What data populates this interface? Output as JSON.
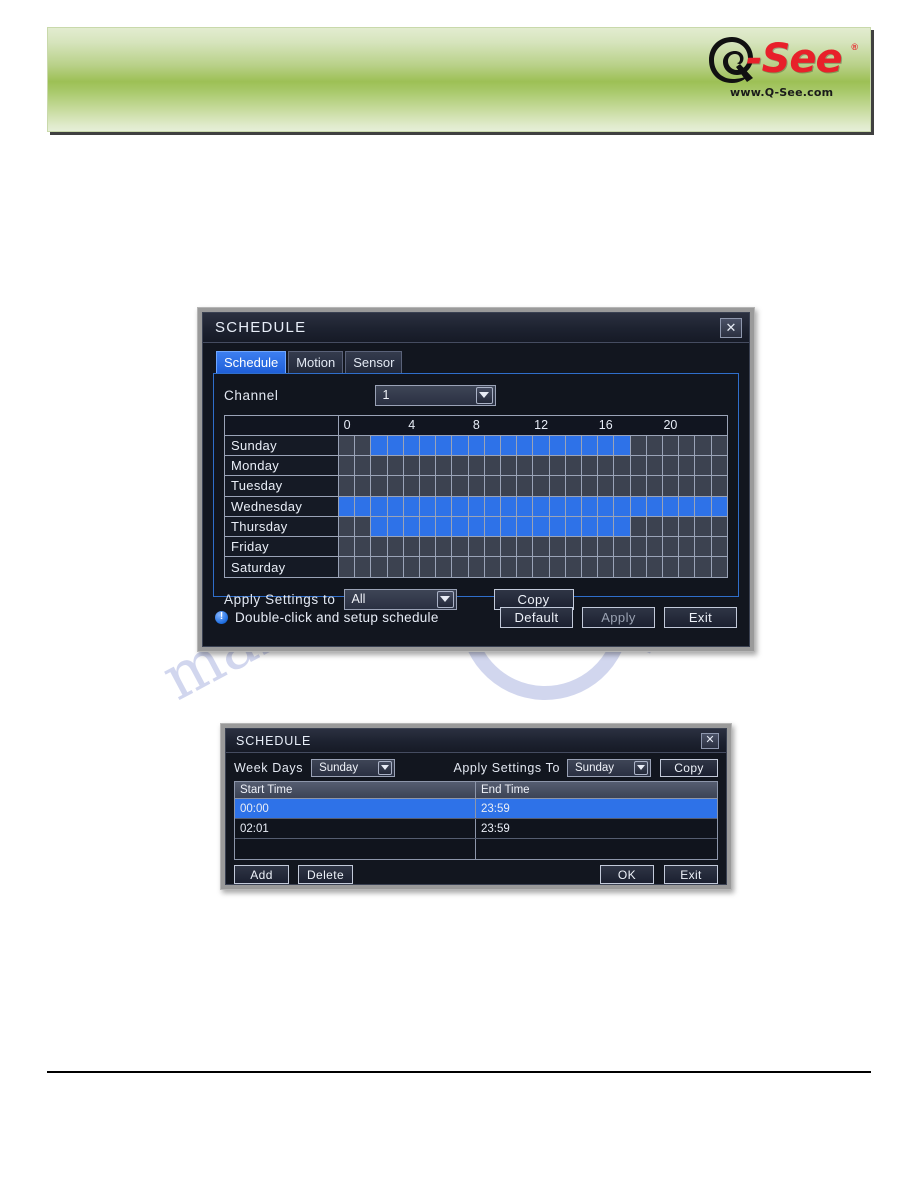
{
  "header": {
    "logo_brand": "Q-See",
    "logo_see_text": "-See",
    "logo_registered": "®",
    "logo_url": "www.Q-See.com"
  },
  "watermark": {
    "text": "manualslib.com"
  },
  "schedule_dialog": {
    "title": "SCHEDULE",
    "close_label": "✕",
    "tabs": [
      {
        "label": "Schedule",
        "active": true
      },
      {
        "label": "Motion",
        "active": false
      },
      {
        "label": "Sensor",
        "active": false
      }
    ],
    "channel_label": "Channel",
    "channel_value": "1",
    "ruler_ticks": [
      "0",
      "4",
      "8",
      "12",
      "16",
      "20"
    ],
    "days": [
      "Sunday",
      "Monday",
      "Tuesday",
      "Wednesday",
      "Thursday",
      "Friday",
      "Saturday"
    ],
    "schedule_grid": [
      [
        0,
        0,
        1,
        1,
        1,
        1,
        1,
        1,
        1,
        1,
        1,
        1,
        1,
        1,
        1,
        1,
        1,
        1,
        0,
        0,
        0,
        0,
        0,
        0
      ],
      [
        0,
        0,
        0,
        0,
        0,
        0,
        0,
        0,
        0,
        0,
        0,
        0,
        0,
        0,
        0,
        0,
        0,
        0,
        0,
        0,
        0,
        0,
        0,
        0
      ],
      [
        0,
        0,
        0,
        0,
        0,
        0,
        0,
        0,
        0,
        0,
        0,
        0,
        0,
        0,
        0,
        0,
        0,
        0,
        0,
        0,
        0,
        0,
        0,
        0
      ],
      [
        1,
        1,
        1,
        1,
        1,
        1,
        1,
        1,
        1,
        1,
        1,
        1,
        1,
        1,
        1,
        1,
        1,
        1,
        1,
        1,
        1,
        1,
        1,
        1
      ],
      [
        0,
        0,
        1,
        1,
        1,
        1,
        1,
        1,
        1,
        1,
        1,
        1,
        1,
        1,
        1,
        1,
        1,
        1,
        0,
        0,
        0,
        0,
        0,
        0
      ],
      [
        0,
        0,
        0,
        0,
        0,
        0,
        0,
        0,
        0,
        0,
        0,
        0,
        0,
        0,
        0,
        0,
        0,
        0,
        0,
        0,
        0,
        0,
        0,
        0
      ],
      [
        0,
        0,
        0,
        0,
        0,
        0,
        0,
        0,
        0,
        0,
        0,
        0,
        0,
        0,
        0,
        0,
        0,
        0,
        0,
        0,
        0,
        0,
        0,
        0
      ]
    ],
    "apply_settings_label": "Apply  Settings  to",
    "apply_settings_value": "All",
    "copy_label": "Copy",
    "hint_icon_glyph": "!",
    "hint_text": "Double-click and setup schedule",
    "default_label": "Default",
    "apply_label": "Apply",
    "exit_label": "Exit",
    "accent_color": "#2e72e8",
    "cell_off_color": "#3c4250"
  },
  "time_dialog": {
    "title": "SCHEDULE",
    "close_label": "✕",
    "week_days_label": "Week  Days",
    "week_days_value": "Sunday",
    "apply_settings_label": "Apply  Settings  To",
    "apply_settings_value": "Sunday",
    "copy_label": "Copy",
    "columns": [
      "Start  Time",
      "End  Time"
    ],
    "rows": [
      {
        "start": "00:00",
        "end": "23:59",
        "selected": true
      },
      {
        "start": "02:01",
        "end": "23:59",
        "selected": false
      },
      {
        "start": "",
        "end": "",
        "selected": false
      }
    ],
    "add_label": "Add",
    "delete_label": "Delete",
    "ok_label": "OK",
    "exit_label": "Exit"
  }
}
